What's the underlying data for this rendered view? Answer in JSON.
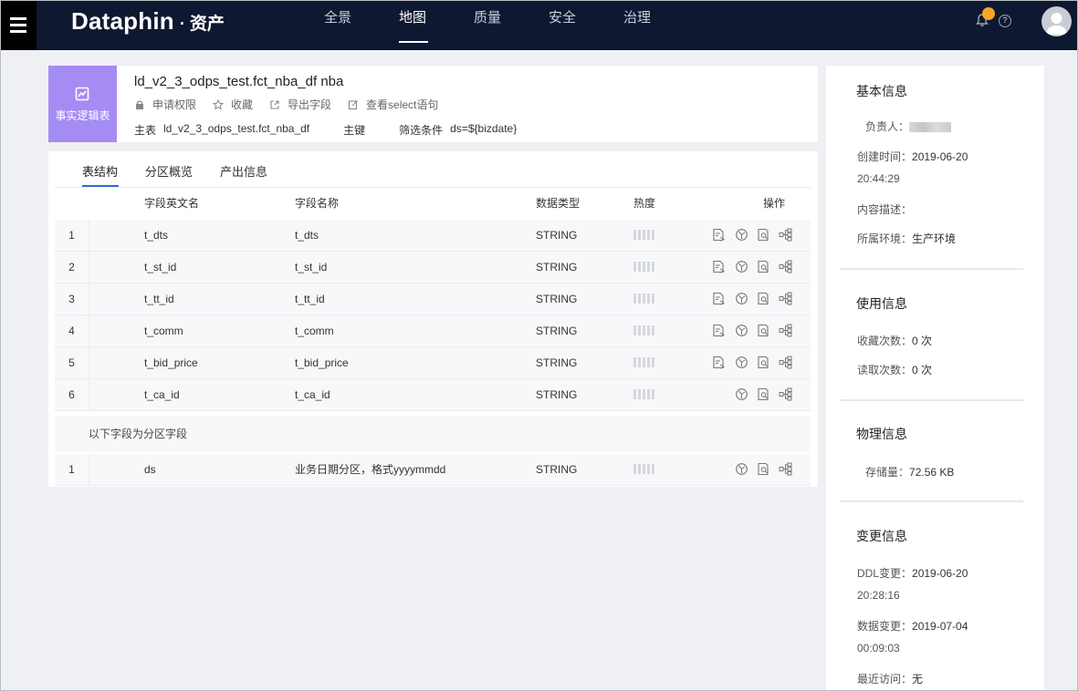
{
  "topbar": {
    "brand": "Dataphin",
    "separator": "·",
    "module": "资产",
    "nav": [
      "全景",
      "地图",
      "质量",
      "安全",
      "治理"
    ],
    "active_nav": "地图",
    "badge_color": "#f5a623"
  },
  "header": {
    "type_label": "事实逻辑表",
    "type_color": "#a58cf4",
    "table_name": "ld_v2_3_odps_test.fct_nba_df nba",
    "actions": [
      "申请权限",
      "收藏",
      "导出字段",
      "查看select语句"
    ],
    "main_table_label": "主表",
    "main_table_value": "ld_v2_3_odps_test.fct_nba_df",
    "primary_key_label": "主键",
    "filter_label": "筛选条件",
    "filter_value": "ds=${bizdate}"
  },
  "tabs": [
    "表结构",
    "分区概览",
    "产出信息"
  ],
  "table": {
    "headers": {
      "en_name": "字段英文名",
      "name": "字段名称",
      "type": "数据类型",
      "heat": "热度",
      "ops": "操作"
    },
    "rows": [
      {
        "idx": "1",
        "en_name": "t_dts",
        "name": "t_dts",
        "type": "STRING"
      },
      {
        "idx": "2",
        "en_name": "t_st_id",
        "name": "t_st_id",
        "type": "STRING"
      },
      {
        "idx": "3",
        "en_name": "t_tt_id",
        "name": "t_tt_id",
        "type": "STRING"
      },
      {
        "idx": "4",
        "en_name": "t_comm",
        "name": "t_comm",
        "type": "STRING"
      },
      {
        "idx": "5",
        "en_name": "t_bid_price",
        "name": "t_bid_price",
        "type": "STRING"
      },
      {
        "idx": "6",
        "en_name": "t_ca_id",
        "name": "t_ca_id",
        "type": "STRING"
      }
    ],
    "partition_label": "以下字段为分区字段",
    "partition_rows": [
      {
        "idx": "1",
        "en_name": "ds",
        "name": "业务日期分区，格式yyyymmdd",
        "type": "STRING"
      }
    ]
  },
  "side": {
    "basic_title": "基本信息",
    "owner_label": "负责人：",
    "created_label": "创建时间：",
    "created_date": "2019-06-20",
    "created_time": "20:44:29",
    "desc_label": "内容描述：",
    "env_label": "所属环境：",
    "env_value": "生产环境",
    "usage_title": "使用信息",
    "fav_label": "收藏次数：",
    "fav_value": "0 次",
    "read_label": "读取次数：",
    "read_value": "0 次",
    "physical_title": "物理信息",
    "storage_label": "存储量：",
    "storage_value": "72.56 KB",
    "change_title": "变更信息",
    "ddl_label": "DDL变更：",
    "ddl_date": "2019-06-20",
    "ddl_time": "20:28:16",
    "data_label": "数据变更：",
    "data_date": "2019-07-04",
    "data_time": "00:09:03",
    "last_label": "最近访问：",
    "last_value": "无"
  }
}
